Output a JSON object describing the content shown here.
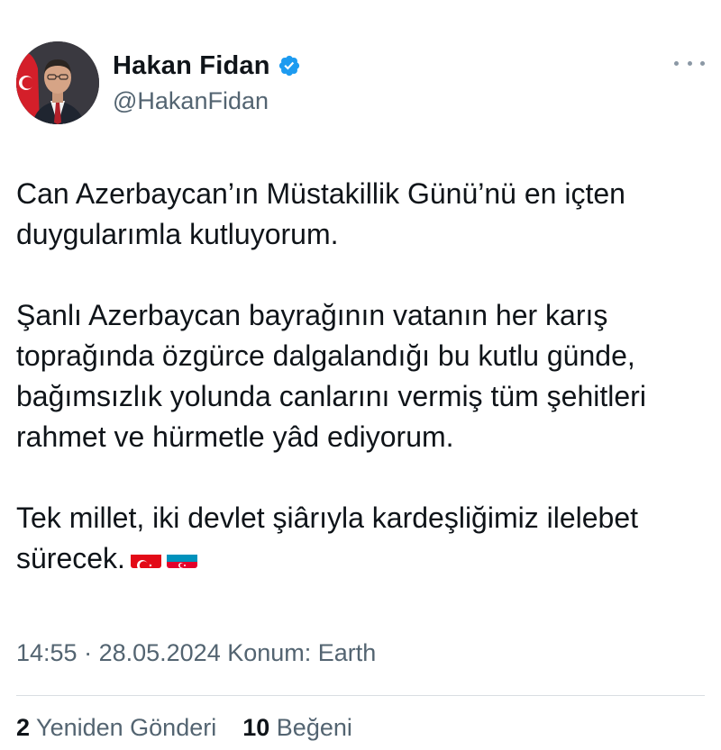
{
  "author": {
    "display_name": "Hakan Fidan",
    "handle": "@HakanFidan",
    "verified": true
  },
  "tweet": {
    "paragraphs": [
      "Can Azerbaycan’ın Müstakillik Günü’nü en içten duygularımla kutluyorum.",
      "Şanlı Azerbaycan bayrağının vatanın her karış toprağında özgürce dalgalandığı bu kutlu günde, bağımsızlık yolunda canlarını vermiş tüm şehitleri rahmet ve hürmetle yâd ediyorum.",
      "Tek millet, iki devlet şiârıyla kardeşliğimiz ilelebet sürecek."
    ],
    "flags": [
      "turkey-flag",
      "azerbaijan-flag"
    ]
  },
  "meta": {
    "time": "14:55",
    "separator": " · ",
    "date": "28.05.2024",
    "location": " Konum: Earth"
  },
  "stats": {
    "reposts_count": "2",
    "reposts_label": " Yeniden Gönderi",
    "likes_count": "10",
    "likes_label": " Beğeni"
  },
  "colors": {
    "text_primary": "#0f1419",
    "text_secondary": "#536471",
    "verified_blue": "#1d9bf0",
    "turkey_red": "#e30a17",
    "az_blue": "#0092bc",
    "az_red": "#e4002b",
    "az_green": "#00af50"
  },
  "icons": {
    "verified": "verified-badge-icon",
    "more": "more-horizontal-icon"
  }
}
